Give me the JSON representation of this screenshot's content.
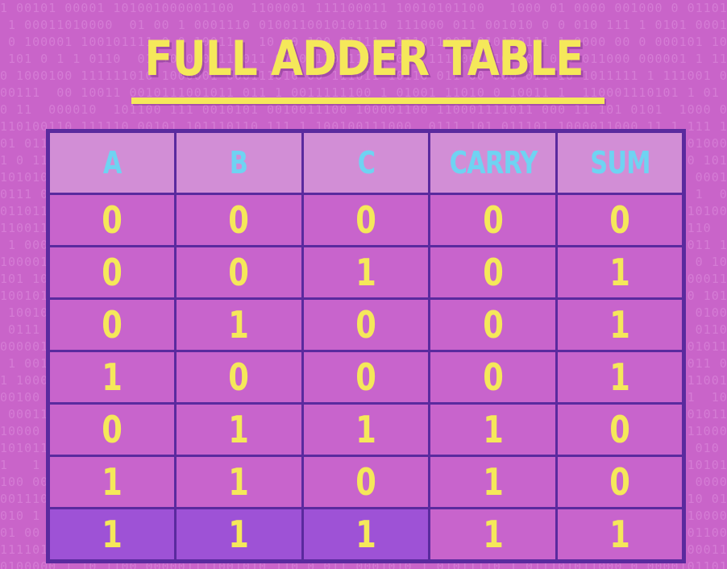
{
  "title": "FULL ADDER TABLE",
  "colors": {
    "background": "#c964c9",
    "title_text": "#f5e85a",
    "header_text": "#6fd3f2",
    "cell_text": "#f5e85a",
    "grid_lines": "#5a2a9e",
    "highlight_cells": "#9e52d6"
  },
  "table": {
    "headers": [
      "A",
      "B",
      "C",
      "CARRY",
      "SUM"
    ],
    "rows": [
      [
        "0",
        "0",
        "0",
        "0",
        "0"
      ],
      [
        "0",
        "0",
        "1",
        "0",
        "1"
      ],
      [
        "0",
        "1",
        "0",
        "0",
        "1"
      ],
      [
        "1",
        "0",
        "0",
        "0",
        "1"
      ],
      [
        "0",
        "1",
        "1",
        "1",
        "0"
      ],
      [
        "1",
        "1",
        "0",
        "1",
        "0"
      ],
      [
        "1",
        "1",
        "1",
        "1",
        "1"
      ]
    ],
    "highlighted_cells": [
      [
        6,
        0
      ],
      [
        6,
        1
      ],
      [
        6,
        2
      ]
    ]
  }
}
